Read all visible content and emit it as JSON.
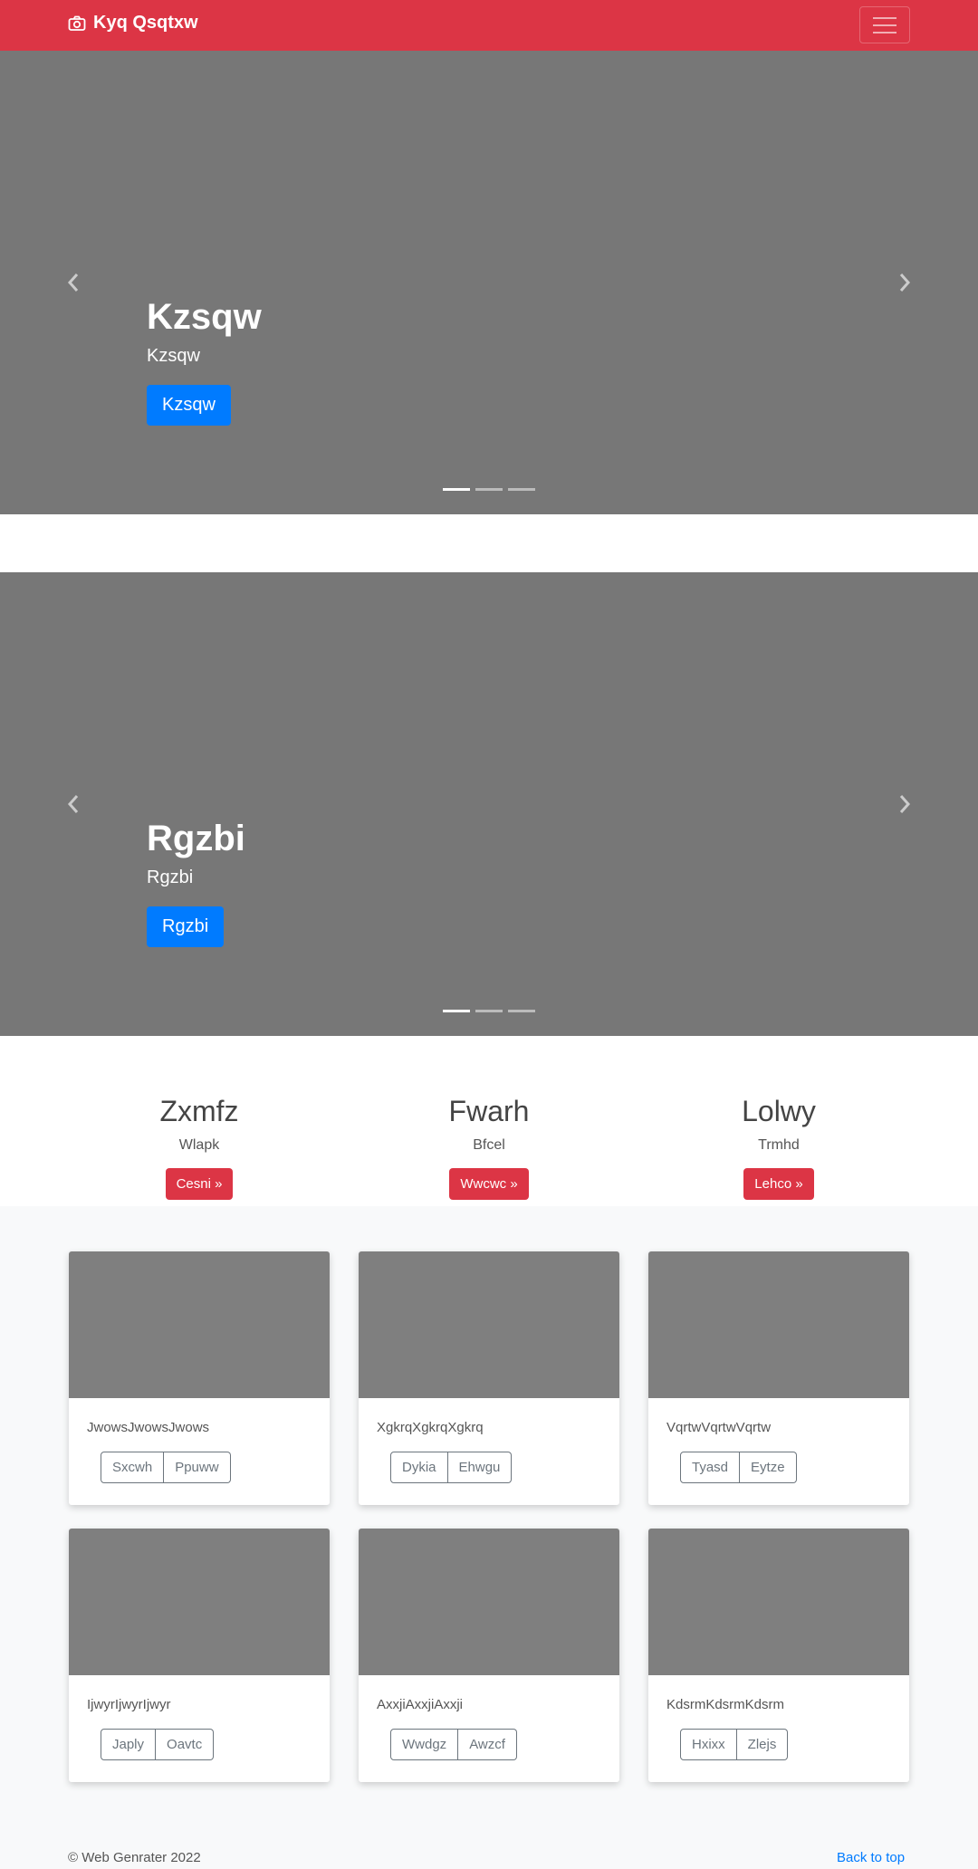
{
  "navbar": {
    "brand": "Kyq Qsqtxw",
    "brand_color": "#dc3545"
  },
  "carousels": [
    {
      "title": "Kzsqw",
      "subtitle": "Kzsqw",
      "button": "Kzsqw"
    },
    {
      "title": "Rgzbi",
      "subtitle": "Rgzbi",
      "button": "Rgzbi"
    }
  ],
  "features": [
    {
      "heading": "Zxmfz",
      "text": "Wlapk",
      "button": "Cesni »"
    },
    {
      "heading": "Fwarh",
      "text": "Bfcel",
      "button": "Wwcwc »"
    },
    {
      "heading": "Lolwy",
      "text": "Trmhd",
      "button": "Lehco »"
    }
  ],
  "cards": [
    {
      "text": "JwowsJwowsJwows",
      "btn1": "Sxcwh",
      "btn2": "Ppuww"
    },
    {
      "text": "XgkrqXgkrqXgkrq",
      "btn1": "Dykia",
      "btn2": "Ehwgu"
    },
    {
      "text": "VqrtwVqrtwVqrtw",
      "btn1": "Tyasd",
      "btn2": "Eytze"
    },
    {
      "text": "IjwyrIjwyrIjwyr",
      "btn1": "Japly",
      "btn2": "Oavtc"
    },
    {
      "text": "AxxjiAxxjiAxxji",
      "btn1": "Wwdgz",
      "btn2": "Awzcf"
    },
    {
      "text": "KdsrmKdsrmKdsrm",
      "btn1": "Hxixx",
      "btn2": "Zlejs"
    }
  ],
  "footer": {
    "copyright": "© Web Genrater 2022",
    "back_to_top": "Back to top"
  }
}
